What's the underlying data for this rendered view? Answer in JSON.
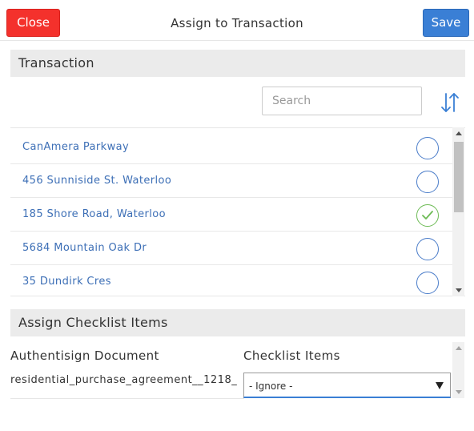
{
  "header": {
    "close_label": "Close",
    "title": "Assign to Transaction",
    "save_label": "Save"
  },
  "transaction": {
    "section_title": "Transaction",
    "search_placeholder": "Search",
    "sort_icon": "sort-arrows-icon",
    "items": [
      {
        "label": "CanAmera Parkway",
        "selected": false
      },
      {
        "label": "456 Sunniside St. Waterloo",
        "selected": false
      },
      {
        "label": "185 Shore Road, Waterloo",
        "selected": true
      },
      {
        "label": "5684 Mountain Oak Dr",
        "selected": false
      },
      {
        "label": "35 Dundirk Cres",
        "selected": false
      }
    ]
  },
  "checklist": {
    "section_title": "Assign Checklist Items",
    "col_document": "Authentisign Document",
    "col_items": "Checklist Items",
    "rows": [
      {
        "document": "residential_purchase_agreement__1218_",
        "selected_option": "- Ignore -"
      }
    ]
  },
  "colors": {
    "close": "#f4312c",
    "save": "#3a7fd5",
    "link": "#3d6fb6",
    "radio": "#4a7cc9",
    "check": "#6dbb55"
  }
}
